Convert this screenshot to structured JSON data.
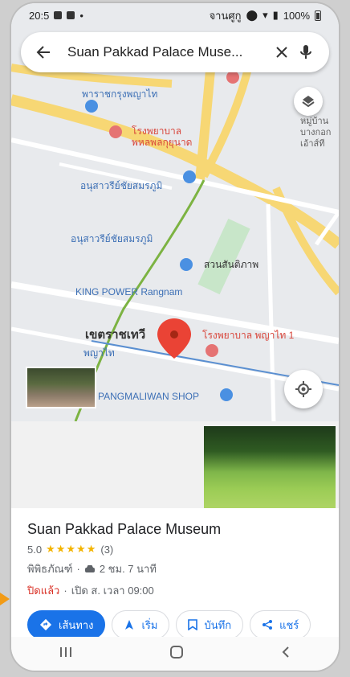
{
  "status": {
    "time": "20:5",
    "carrier": "จานศูกู",
    "battery": "100%"
  },
  "search": {
    "query": "Suan Pakkad Palace Muse..."
  },
  "map": {
    "labels": {
      "hospital_top": "พาราชกรุงพญาไท",
      "hospital_top2": "โรงพยาบาล",
      "hospital_top3": "พหลพลกุยุนาด",
      "monument": "อนุสาวรีย์ชัยสมรภูมิ",
      "monument2": "อนุสาวรีย์ชัยสมรภูมิ",
      "park": "สวนสันติภาพ",
      "king_power": "KING POWER Rangnam",
      "district": "เขตราชเทวี",
      "hospital": "โรงพยาบาล พญาไท 1",
      "phayathai": "พญาไท",
      "mall": "PANGMALIWAN SHOP",
      "right_label": "หมู่บ้านบางกอกเอ้าส์ที"
    }
  },
  "place": {
    "name": "Suan Pakkad Palace Museum",
    "rating": "5.0",
    "stars": "★★★★★",
    "reviews": "(3)",
    "category": "พิพิธภัณฑ์",
    "travel_time": "2 ชม. 7 นาที",
    "status": "ปิดแล้ว",
    "opens": "เปิด ส. เวลา 09:00"
  },
  "actions": {
    "directions": "เส้นทาง",
    "start": "เริ่ม",
    "save": "บันทึก",
    "share": "แชร์"
  }
}
